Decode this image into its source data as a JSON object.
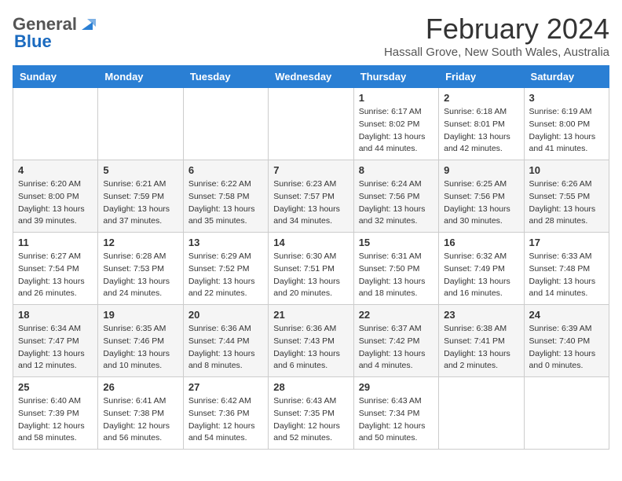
{
  "header": {
    "logo_general": "General",
    "logo_blue": "Blue",
    "month_title": "February 2024",
    "location": "Hassall Grove, New South Wales, Australia"
  },
  "weekdays": [
    "Sunday",
    "Monday",
    "Tuesday",
    "Wednesday",
    "Thursday",
    "Friday",
    "Saturday"
  ],
  "weeks": [
    [
      {
        "day": "",
        "info": ""
      },
      {
        "day": "",
        "info": ""
      },
      {
        "day": "",
        "info": ""
      },
      {
        "day": "",
        "info": ""
      },
      {
        "day": "1",
        "info": "Sunrise: 6:17 AM\nSunset: 8:02 PM\nDaylight: 13 hours\nand 44 minutes."
      },
      {
        "day": "2",
        "info": "Sunrise: 6:18 AM\nSunset: 8:01 PM\nDaylight: 13 hours\nand 42 minutes."
      },
      {
        "day": "3",
        "info": "Sunrise: 6:19 AM\nSunset: 8:00 PM\nDaylight: 13 hours\nand 41 minutes."
      }
    ],
    [
      {
        "day": "4",
        "info": "Sunrise: 6:20 AM\nSunset: 8:00 PM\nDaylight: 13 hours\nand 39 minutes."
      },
      {
        "day": "5",
        "info": "Sunrise: 6:21 AM\nSunset: 7:59 PM\nDaylight: 13 hours\nand 37 minutes."
      },
      {
        "day": "6",
        "info": "Sunrise: 6:22 AM\nSunset: 7:58 PM\nDaylight: 13 hours\nand 35 minutes."
      },
      {
        "day": "7",
        "info": "Sunrise: 6:23 AM\nSunset: 7:57 PM\nDaylight: 13 hours\nand 34 minutes."
      },
      {
        "day": "8",
        "info": "Sunrise: 6:24 AM\nSunset: 7:56 PM\nDaylight: 13 hours\nand 32 minutes."
      },
      {
        "day": "9",
        "info": "Sunrise: 6:25 AM\nSunset: 7:56 PM\nDaylight: 13 hours\nand 30 minutes."
      },
      {
        "day": "10",
        "info": "Sunrise: 6:26 AM\nSunset: 7:55 PM\nDaylight: 13 hours\nand 28 minutes."
      }
    ],
    [
      {
        "day": "11",
        "info": "Sunrise: 6:27 AM\nSunset: 7:54 PM\nDaylight: 13 hours\nand 26 minutes."
      },
      {
        "day": "12",
        "info": "Sunrise: 6:28 AM\nSunset: 7:53 PM\nDaylight: 13 hours\nand 24 minutes."
      },
      {
        "day": "13",
        "info": "Sunrise: 6:29 AM\nSunset: 7:52 PM\nDaylight: 13 hours\nand 22 minutes."
      },
      {
        "day": "14",
        "info": "Sunrise: 6:30 AM\nSunset: 7:51 PM\nDaylight: 13 hours\nand 20 minutes."
      },
      {
        "day": "15",
        "info": "Sunrise: 6:31 AM\nSunset: 7:50 PM\nDaylight: 13 hours\nand 18 minutes."
      },
      {
        "day": "16",
        "info": "Sunrise: 6:32 AM\nSunset: 7:49 PM\nDaylight: 13 hours\nand 16 minutes."
      },
      {
        "day": "17",
        "info": "Sunrise: 6:33 AM\nSunset: 7:48 PM\nDaylight: 13 hours\nand 14 minutes."
      }
    ],
    [
      {
        "day": "18",
        "info": "Sunrise: 6:34 AM\nSunset: 7:47 PM\nDaylight: 13 hours\nand 12 minutes."
      },
      {
        "day": "19",
        "info": "Sunrise: 6:35 AM\nSunset: 7:46 PM\nDaylight: 13 hours\nand 10 minutes."
      },
      {
        "day": "20",
        "info": "Sunrise: 6:36 AM\nSunset: 7:44 PM\nDaylight: 13 hours\nand 8 minutes."
      },
      {
        "day": "21",
        "info": "Sunrise: 6:36 AM\nSunset: 7:43 PM\nDaylight: 13 hours\nand 6 minutes."
      },
      {
        "day": "22",
        "info": "Sunrise: 6:37 AM\nSunset: 7:42 PM\nDaylight: 13 hours\nand 4 minutes."
      },
      {
        "day": "23",
        "info": "Sunrise: 6:38 AM\nSunset: 7:41 PM\nDaylight: 13 hours\nand 2 minutes."
      },
      {
        "day": "24",
        "info": "Sunrise: 6:39 AM\nSunset: 7:40 PM\nDaylight: 13 hours\nand 0 minutes."
      }
    ],
    [
      {
        "day": "25",
        "info": "Sunrise: 6:40 AM\nSunset: 7:39 PM\nDaylight: 12 hours\nand 58 minutes."
      },
      {
        "day": "26",
        "info": "Sunrise: 6:41 AM\nSunset: 7:38 PM\nDaylight: 12 hours\nand 56 minutes."
      },
      {
        "day": "27",
        "info": "Sunrise: 6:42 AM\nSunset: 7:36 PM\nDaylight: 12 hours\nand 54 minutes."
      },
      {
        "day": "28",
        "info": "Sunrise: 6:43 AM\nSunset: 7:35 PM\nDaylight: 12 hours\nand 52 minutes."
      },
      {
        "day": "29",
        "info": "Sunrise: 6:43 AM\nSunset: 7:34 PM\nDaylight: 12 hours\nand 50 minutes."
      },
      {
        "day": "",
        "info": ""
      },
      {
        "day": "",
        "info": ""
      }
    ]
  ]
}
